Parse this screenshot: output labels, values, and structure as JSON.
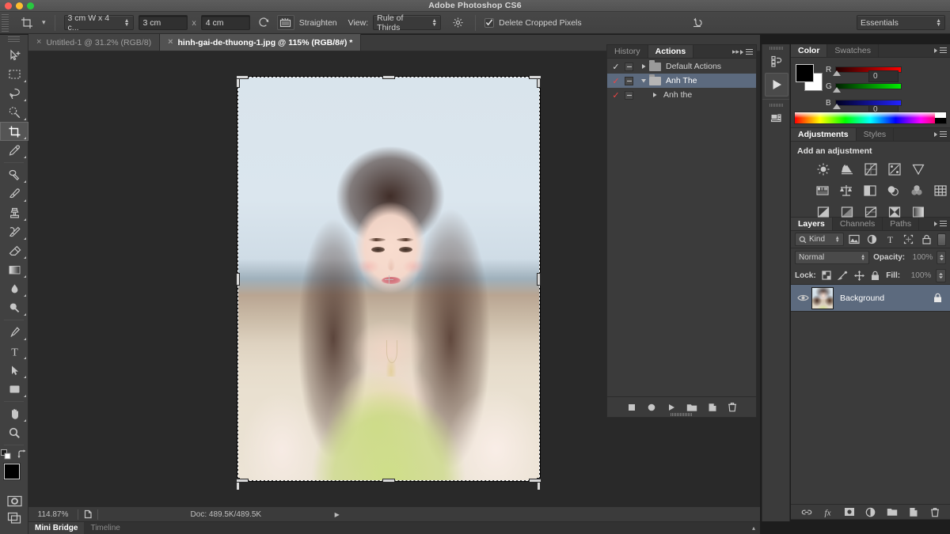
{
  "window": {
    "title": "Adobe Photoshop CS6",
    "traffic_lights": [
      "close",
      "minimize",
      "zoom"
    ]
  },
  "options_bar": {
    "tool_icon": "crop-tool-icon",
    "preset_dropdown_arrow": "tool-preset-arrow",
    "ratio_preset": "3 cm W x 4 c...",
    "width_value": "3 cm",
    "separator_x": "x",
    "height_value": "4 cm",
    "swap_icon": "swap-dimensions-icon",
    "straighten_icon": "straighten-icon",
    "straighten_label": "Straighten",
    "view_label": "View:",
    "view_value": "Rule of Thirds",
    "settings_icon": "gear-icon",
    "delete_cropped_checked": true,
    "delete_cropped_label": "Delete Cropped Pixels",
    "reset_icon": "reset-icon",
    "workspace": "Essentials"
  },
  "document_tabs": [
    {
      "label": "Untitled-1 @ 31.2% (RGB/8)",
      "active": false,
      "close": "×"
    },
    {
      "label": "hinh-gai-de-thuong-1.jpg @ 115% (RGB/8#) *",
      "active": true,
      "close": "×"
    }
  ],
  "toolbar": {
    "tools": [
      {
        "name": "move-tool",
        "active": false,
        "corner": false
      },
      {
        "name": "rectangular-marquee-tool",
        "active": false,
        "corner": true
      },
      {
        "name": "lasso-tool",
        "active": false,
        "corner": true
      },
      {
        "name": "quick-selection-tool",
        "active": false,
        "corner": true
      },
      {
        "name": "crop-tool",
        "active": true,
        "corner": true
      },
      {
        "name": "eyedropper-tool",
        "active": false,
        "corner": true
      },
      {
        "name": "spot-healing-brush-tool",
        "active": false,
        "corner": true
      },
      {
        "name": "brush-tool",
        "active": false,
        "corner": true
      },
      {
        "name": "clone-stamp-tool",
        "active": false,
        "corner": true
      },
      {
        "name": "history-brush-tool",
        "active": false,
        "corner": true
      },
      {
        "name": "eraser-tool",
        "active": false,
        "corner": true
      },
      {
        "name": "gradient-tool",
        "active": false,
        "corner": true
      },
      {
        "name": "blur-tool",
        "active": false,
        "corner": true
      },
      {
        "name": "dodge-tool",
        "active": false,
        "corner": true
      },
      {
        "name": "pen-tool",
        "active": false,
        "corner": true
      },
      {
        "name": "type-tool",
        "active": false,
        "corner": true
      },
      {
        "name": "path-selection-tool",
        "active": false,
        "corner": true
      },
      {
        "name": "rectangle-tool",
        "active": false,
        "corner": true
      },
      {
        "name": "hand-tool",
        "active": false,
        "corner": true
      },
      {
        "name": "zoom-tool",
        "active": false,
        "corner": false
      }
    ],
    "default_colors_icon": "default-colors-icon",
    "swap_colors_icon": "swap-colors-icon",
    "foreground_color": "#000000",
    "background_color": "#ffffff",
    "quick_mask_icon": "quick-mask-icon",
    "screen_mode_icon": "screen-mode-icon"
  },
  "canvas": {
    "image_name": "hinh-gai-de-thuong-1.jpg",
    "crop_overlay": "rule-of-thirds",
    "crop_cross_icon": "crop-center-crosshair"
  },
  "status_bar": {
    "zoom": "114.87%",
    "doc_icon": "document-profile-icon",
    "doc_info": "Doc: 489.5K/489.5K",
    "expand_arrow": "▶"
  },
  "bottom_tabs": [
    {
      "label": "Mini Bridge",
      "active": true
    },
    {
      "label": "Timeline",
      "active": false
    }
  ],
  "actions_panel": {
    "tabs": [
      {
        "label": "History",
        "active": false
      },
      {
        "label": "Actions",
        "active": true
      }
    ],
    "collapse_icon": "double-arrow-icon",
    "menu_icon": "panel-menu-icon",
    "rows": [
      {
        "label": "Default Actions",
        "check": "✓",
        "check_color": "white",
        "expanded": false,
        "selected": false,
        "indent": 0,
        "type": "folder"
      },
      {
        "label": "Anh The",
        "check": "✓",
        "check_color": "red",
        "expanded": true,
        "selected": true,
        "indent": 0,
        "type": "folder"
      },
      {
        "label": "Anh the",
        "check": "✓",
        "check_color": "red",
        "expanded": false,
        "selected": false,
        "indent": 1,
        "type": "action"
      }
    ],
    "footer_buttons": [
      "stop-playing-icon",
      "record-icon",
      "play-icon",
      "new-set-icon",
      "new-action-icon",
      "delete-icon"
    ]
  },
  "mini_dock": {
    "buttons": [
      "history-panel-icon",
      "play-action-icon",
      "mini-bridge-icon"
    ]
  },
  "color_panel": {
    "tabs": [
      {
        "label": "Color",
        "active": true
      },
      {
        "label": "Swatches",
        "active": false
      }
    ],
    "menu_icon": "panel-menu-icon",
    "foreground": "#000000",
    "background": "#ffffff",
    "channels": [
      {
        "label": "R",
        "value": "0",
        "track_from": "#200000",
        "track_to": "#ff0000"
      },
      {
        "label": "G",
        "value": "0",
        "track_from": "#002000",
        "track_to": "#00ff00"
      },
      {
        "label": "B",
        "value": "0",
        "track_from": "#000020",
        "track_to": "#0000ff"
      }
    ],
    "spectrum": "color-ramp"
  },
  "adjustments_panel": {
    "tabs": [
      {
        "label": "Adjustments",
        "active": true
      },
      {
        "label": "Styles",
        "active": false
      }
    ],
    "menu_icon": "panel-menu-icon",
    "heading": "Add an adjustment",
    "row1": [
      "brightness-contrast-icon",
      "levels-icon",
      "curves-icon",
      "exposure-icon",
      "vibrance-icon"
    ],
    "row2": [
      "hue-saturation-icon",
      "color-balance-icon",
      "black-white-icon",
      "photo-filter-icon",
      "channel-mixer-icon",
      "color-lookup-icon"
    ],
    "row3": [
      "invert-icon",
      "posterize-icon",
      "threshold-icon",
      "selective-color-icon",
      "gradient-map-icon"
    ]
  },
  "layers_panel": {
    "tabs": [
      {
        "label": "Layers",
        "active": true
      },
      {
        "label": "Channels",
        "active": false
      },
      {
        "label": "Paths",
        "active": false
      }
    ],
    "menu_icon": "panel-menu-icon",
    "filter_kind": "Kind",
    "filter_icons": [
      "pixel-filter-icon",
      "adjustment-filter-icon",
      "type-filter-icon",
      "shape-filter-icon",
      "smart-object-filter-icon"
    ],
    "blend_mode": "Normal",
    "opacity_label": "Opacity:",
    "opacity_value": "100%",
    "lock_label": "Lock:",
    "lock_icons": [
      "lock-transparent-pixels-icon",
      "lock-image-pixels-icon",
      "lock-position-icon",
      "lock-all-icon"
    ],
    "fill_label": "Fill:",
    "fill_value": "100%",
    "layers": [
      {
        "name": "Background",
        "visible": true,
        "locked": true,
        "selected": true
      }
    ],
    "footer_buttons": [
      "link-layers-icon",
      "layer-style-icon",
      "layer-mask-icon",
      "new-fill-adjustment-icon",
      "new-group-icon",
      "new-layer-icon",
      "delete-layer-icon"
    ]
  },
  "colors": {
    "accent_selection": "#5c6a7e",
    "panel_bg": "#3b3b3b",
    "canvas_bg": "#292929",
    "toolbar_bg": "#414141",
    "checkmark_red": "#ef4444"
  }
}
